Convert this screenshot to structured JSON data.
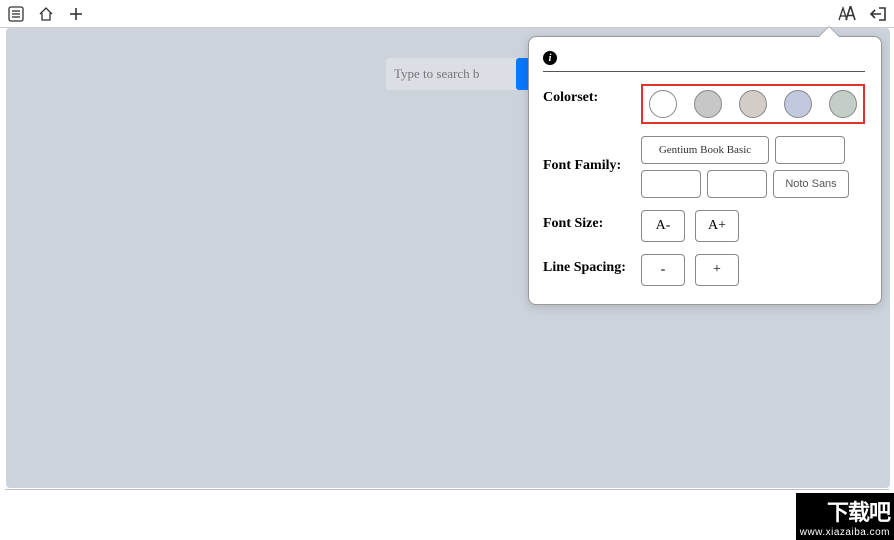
{
  "toolbar": {
    "left_icons": [
      "list-icon",
      "home-icon",
      "add-icon"
    ],
    "right_icons": [
      "text-style-icon",
      "exit-icon"
    ]
  },
  "search": {
    "placeholder": "Type to search b"
  },
  "popover": {
    "info_glyph": "i",
    "colorset": {
      "label": "Colorset:",
      "swatches": [
        "#ffffff",
        "#c7c7c7",
        "#d4cdc7",
        "#c2c9df",
        "#c5cec6"
      ]
    },
    "font_family": {
      "label": "Font Family:",
      "options": [
        "Gentium Book Basic",
        "",
        "",
        "",
        "Noto Sans"
      ]
    },
    "font_size": {
      "label": "Font Size:",
      "decrease": "A-",
      "increase": "A+"
    },
    "line_spacing": {
      "label": "Line Spacing:",
      "decrease": "-",
      "increase": "+"
    }
  },
  "watermark": {
    "title": "下载吧",
    "url": "www.xiazaiba.com"
  }
}
